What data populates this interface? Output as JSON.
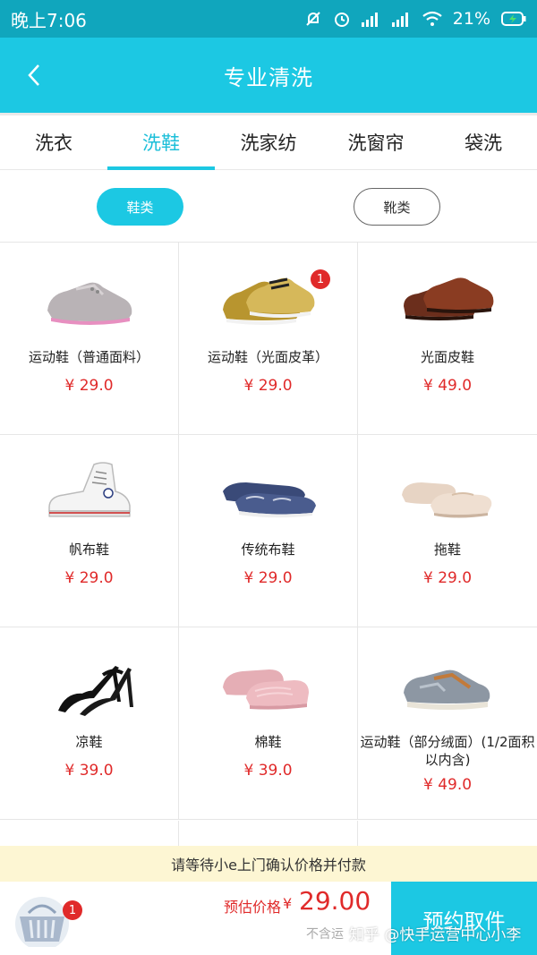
{
  "status_bar": {
    "time": "晚上7:06",
    "battery": "21%"
  },
  "header": {
    "title": "专业清洗"
  },
  "tabs": [
    {
      "label": "洗衣",
      "active": false
    },
    {
      "label": "洗鞋",
      "active": true
    },
    {
      "label": "洗家纺",
      "active": false
    },
    {
      "label": "洗窗帘",
      "active": false
    },
    {
      "label": "袋洗",
      "active": false
    }
  ],
  "filters": {
    "active": "鞋类",
    "inactive": "靴类"
  },
  "products": [
    {
      "name": "运动鞋（普通面料）",
      "price": "29.0",
      "icon": "sneaker-mesh"
    },
    {
      "name": "运动鞋（光面皮革）",
      "price": "29.0",
      "icon": "sneaker-gold",
      "badge": "1"
    },
    {
      "name": "光面皮鞋",
      "price": "49.0",
      "icon": "leather-shoe"
    },
    {
      "name": "帆布鞋",
      "price": "29.0",
      "icon": "canvas-high-top"
    },
    {
      "name": "传统布鞋",
      "price": "29.0",
      "icon": "cloth-shoe"
    },
    {
      "name": "拖鞋",
      "price": "29.0",
      "icon": "slipper"
    },
    {
      "name": "凉鞋",
      "price": "39.0",
      "icon": "sandal"
    },
    {
      "name": "棉鞋",
      "price": "39.0",
      "icon": "cotton-shoe"
    },
    {
      "name": "运动鞋（部分绒面）(1/2面积以内含)",
      "price": "49.0",
      "icon": "sneaker-suede"
    }
  ],
  "currency": "¥",
  "notice": "请等待小e上门确认价格并付款",
  "bottom": {
    "basket_count": "1",
    "estimate_label": "预估价格",
    "estimate_currency": "¥",
    "estimate_value": "29.00",
    "sub_note": "不含运",
    "book_button": "预约取件"
  },
  "watermark": "知乎 @快手运营中心小李",
  "colors": {
    "accent": "#1cc8e3",
    "status_bar": "#10a6bd",
    "price": "#e02a2a",
    "notice_bg": "#fdf6d3"
  }
}
